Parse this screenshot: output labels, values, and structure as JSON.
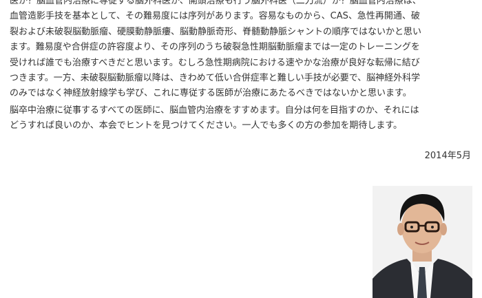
{
  "article": {
    "paragraph1": [
      "医か？脳血管内治療に専従する脳外科医か、開頭治療も行う脳外科医（二刀流）か？脳血管内治療は、",
      "血管造影手技を基本として、その難易度には序列があります。容易なものから、CAS、急性再開通、破",
      "裂および未破裂脳動脈瘤、硬膜動静脈瘻、脳動静脈奇形、脊髄動静脈シャントの順序ではないかと思い",
      "ます。難易度や合併症の許容度より、その序列のうち破裂急性期脳動脈瘤までは一定のトレーニングを",
      "受ければ誰でも治療すべきだと思います。むしろ急性期病院における速やかな治療が良好な転帰に結び",
      "つきます。一方、未破裂脳動脈瘤以降は、きわめて低い合併症率と難しい手技が必要で、脳神経外科学",
      "のみではなく神経放射線学も学び、これに専従する医師が治療にあたるべきではないかと思います。"
    ],
    "paragraph2": [
      "脳卒中治療に従事するすべての医師に、脳血管内治療をすすめます。自分は何を目指すのか、それには",
      "どうすれば良いのか、本会でヒントを見つけてください。一人でも多くの方の参加を期待します。"
    ],
    "date": "2014年5月"
  }
}
